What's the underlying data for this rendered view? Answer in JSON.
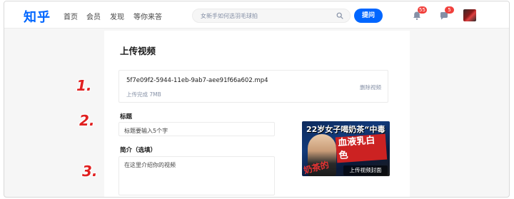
{
  "nav": {
    "logo": "知乎",
    "links": [
      "首页",
      "会员",
      "发现",
      "等你来答"
    ],
    "search_placeholder": "女新手如何选羽毛球拍",
    "ask_label": "提问",
    "notification_count": "55",
    "message_count": "5"
  },
  "page": {
    "title": "上传视频",
    "file": {
      "name": "5f7e09f2-5944-11eb-9ab7-aee91f66a602.mp4",
      "status": "上传完成 7MB",
      "delete_label": "删除视频"
    },
    "title_field": {
      "label": "标题",
      "value": "标题要输入5个字"
    },
    "intro_field": {
      "label": "简介（选填）",
      "value": "在这里介绍你的视频"
    },
    "cover": {
      "line1": "22岁女子喝奶茶“中毒",
      "line2": "血液乳白色",
      "line3": "奶茶的",
      "button": "上传视频封面"
    }
  },
  "steps": [
    "1.",
    "2.",
    "3."
  ],
  "colors": {
    "brand": "#0066ff",
    "badge": "#f1403c",
    "step": "#e02020"
  }
}
